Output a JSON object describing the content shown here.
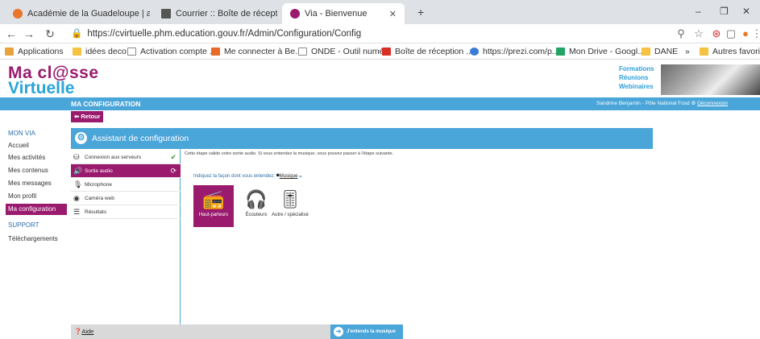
{
  "browser": {
    "tabs": [
      {
        "title": "Académie de la Guadeloupe | ac",
        "favicon_color": "#e8762b"
      },
      {
        "title": "Courrier :: Boîte de réception",
        "favicon_color": "#555555"
      },
      {
        "title": "Via - Bienvenue",
        "favicon_color": "#9a1b6e"
      }
    ],
    "new_tab": "+",
    "window_controls": [
      "–",
      "❐",
      "✕"
    ],
    "url": "https://cvirtuelle.phm.education.gouv.fr/Admin/Configuration/Config",
    "bookmarks": [
      {
        "label": "Applications",
        "color": "#e8a33d"
      },
      {
        "label": "idées deco",
        "color": "#f5c242"
      },
      {
        "label": "Activation compte ...",
        "color": "#888888"
      },
      {
        "label": "Me connecter à Be...",
        "color": "#e86a2b"
      },
      {
        "label": "ONDE - Outil numé...",
        "color": "#888888"
      },
      {
        "label": "Boîte de réception ...",
        "color": "#d93025"
      },
      {
        "label": "https://prezi.com/p...",
        "color": "#3b7bd6"
      },
      {
        "label": "Mon Drive - Googl...",
        "color": "#1fa463"
      },
      {
        "label": "DANE",
        "color": "#f5c242"
      },
      {
        "label": "»",
        "color": ""
      },
      {
        "label": "Autres favoris",
        "color": "#f5c242"
      }
    ]
  },
  "brand": {
    "line1": "Ma cl@sse",
    "line2": "Virtuelle"
  },
  "promo": [
    "Formations",
    "Réunions",
    "Webinaires"
  ],
  "header": {
    "section_title": "MA CONFIGURATION",
    "user": "Sandrine Benjamin - Pôle National Fosd",
    "logout": "Déconnexion"
  },
  "back_label": "Retour",
  "sidebar": {
    "items": [
      {
        "label": "MON VIA",
        "head": true
      },
      {
        "label": "Accueil"
      },
      {
        "label": "Mes activités"
      },
      {
        "label": "Mes contenus"
      },
      {
        "label": "Mes messages"
      },
      {
        "label": "Mon profil"
      },
      {
        "label": "Ma configuration",
        "active": true
      },
      {
        "label": "SUPPORT",
        "head": true
      },
      {
        "label": "Téléchargements"
      }
    ]
  },
  "wizard": {
    "title": "Assistant de configuration",
    "steps": [
      {
        "label": "Connexion aux serveurs",
        "icon": "server-icon",
        "status": "done"
      },
      {
        "label": "Sortie audio",
        "icon": "speaker-icon",
        "status": "active"
      },
      {
        "label": "Microphone",
        "icon": "microphone-icon",
        "status": ""
      },
      {
        "label": "Caméra web",
        "icon": "webcam-icon",
        "status": ""
      },
      {
        "label": "Résultats",
        "icon": "list-icon",
        "status": ""
      }
    ],
    "instruction": "Cette étape valide votre sortie audio. Si vous entendez la musique, vous pouvez passer à l'étape suivante.",
    "how_label": "Indiquez la façon dont vous entendez:",
    "music_label": "Musique",
    "options": [
      {
        "label": "Haut-parleurs",
        "icon": "speakers-icon",
        "selected": true
      },
      {
        "label": "Écouteurs",
        "icon": "headphones-icon",
        "selected": false
      },
      {
        "label": "Autre / spécialisé",
        "icon": "mixer-icon",
        "selected": false
      }
    ],
    "help_label": "Aide",
    "next_label": "J'entends la musique"
  },
  "colors": {
    "brand_magenta": "#9a1b6e",
    "brand_blue": "#4aa5d9"
  }
}
